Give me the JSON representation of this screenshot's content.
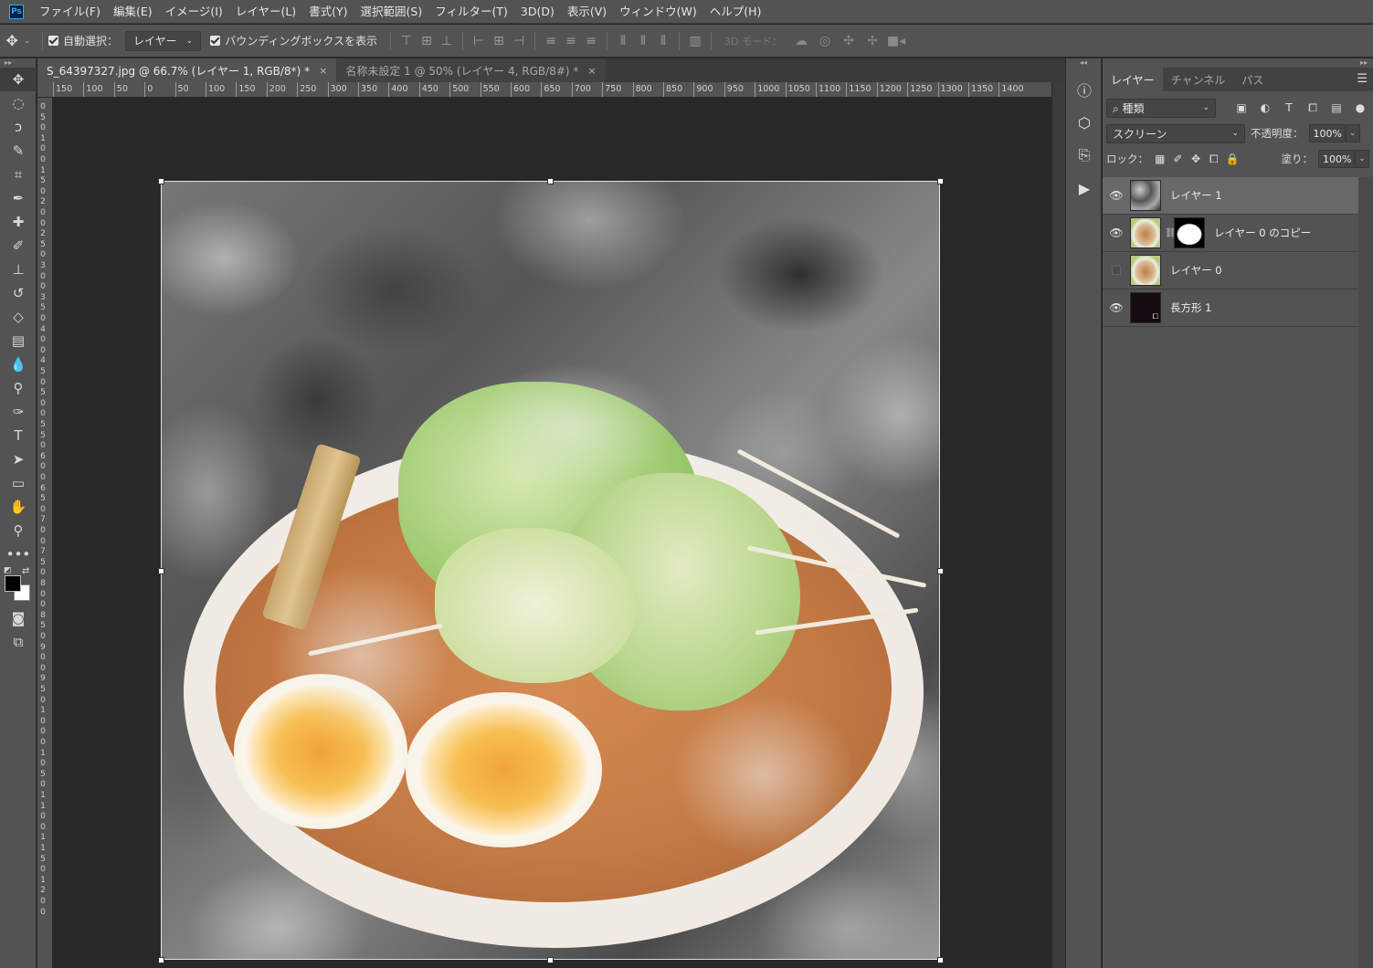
{
  "menubar": {
    "logo": "Ps",
    "items": [
      "ファイル(F)",
      "編集(E)",
      "イメージ(I)",
      "レイヤー(L)",
      "書式(Y)",
      "選択範囲(S)",
      "フィルター(T)",
      "3D(D)",
      "表示(V)",
      "ウィンドウ(W)",
      "ヘルプ(H)"
    ]
  },
  "options": {
    "auto_select_label": "自動選択：",
    "auto_select_value": "レイヤー",
    "bounding_box_label": "バウンディングボックスを表示",
    "mode_3d_label": "3D モード："
  },
  "tabs": [
    {
      "label": "S_64397327.jpg @ 66.7% (レイヤー 1, RGB/8*) *",
      "close": "×"
    },
    {
      "label": "名称未設定 1 @ 50% (レイヤー 4, RGB/8#) *",
      "close": "×"
    }
  ],
  "ruler_top": [
    "150",
    "100",
    "50",
    "0",
    "50",
    "100",
    "150",
    "200",
    "250",
    "300",
    "350",
    "400",
    "450",
    "500",
    "550",
    "600",
    "650",
    "700",
    "750",
    "800",
    "850",
    "900",
    "950",
    "1000",
    "1050",
    "1100",
    "1150",
    "1200",
    "1250",
    "1300",
    "1350",
    "1400"
  ],
  "ruler_left": [
    "0",
    "5",
    "0",
    "1",
    "0",
    "0",
    "1",
    "5",
    "0",
    "2",
    "0",
    "0",
    "2",
    "5",
    "0",
    "3",
    "0",
    "0",
    "3",
    "5",
    "0",
    "4",
    "0",
    "0",
    "4",
    "5",
    "0",
    "5",
    "0",
    "0",
    "5",
    "5",
    "0",
    "6",
    "0",
    "0",
    "6",
    "5",
    "0",
    "7",
    "0",
    "0",
    "7",
    "5",
    "0",
    "8",
    "0",
    "0",
    "8",
    "5",
    "0",
    "9",
    "0",
    "0",
    "9",
    "5",
    "0",
    "1",
    "0",
    "0",
    "0",
    "1",
    "0",
    "5",
    "0",
    "1",
    "1",
    "0",
    "0",
    "1",
    "1",
    "5",
    "0",
    "1",
    "2",
    "0",
    "0"
  ],
  "layers_panel": {
    "tabs": [
      "レイヤー",
      "チャンネル",
      "パス"
    ],
    "filter_kind": "種類",
    "blend_mode": "スクリーン",
    "opacity_label": "不透明度：",
    "opacity_value": "100%",
    "lock_label": "ロック：",
    "fill_label": "塗り：",
    "fill_value": "100%",
    "layers": [
      {
        "name": "レイヤー 1",
        "visible": true,
        "selected": true
      },
      {
        "name": "レイヤー 0 のコピー",
        "visible": true,
        "selected": false
      },
      {
        "name": "レイヤー 0",
        "visible": false,
        "selected": false
      },
      {
        "name": "長方形 1",
        "visible": true,
        "selected": false
      }
    ]
  }
}
